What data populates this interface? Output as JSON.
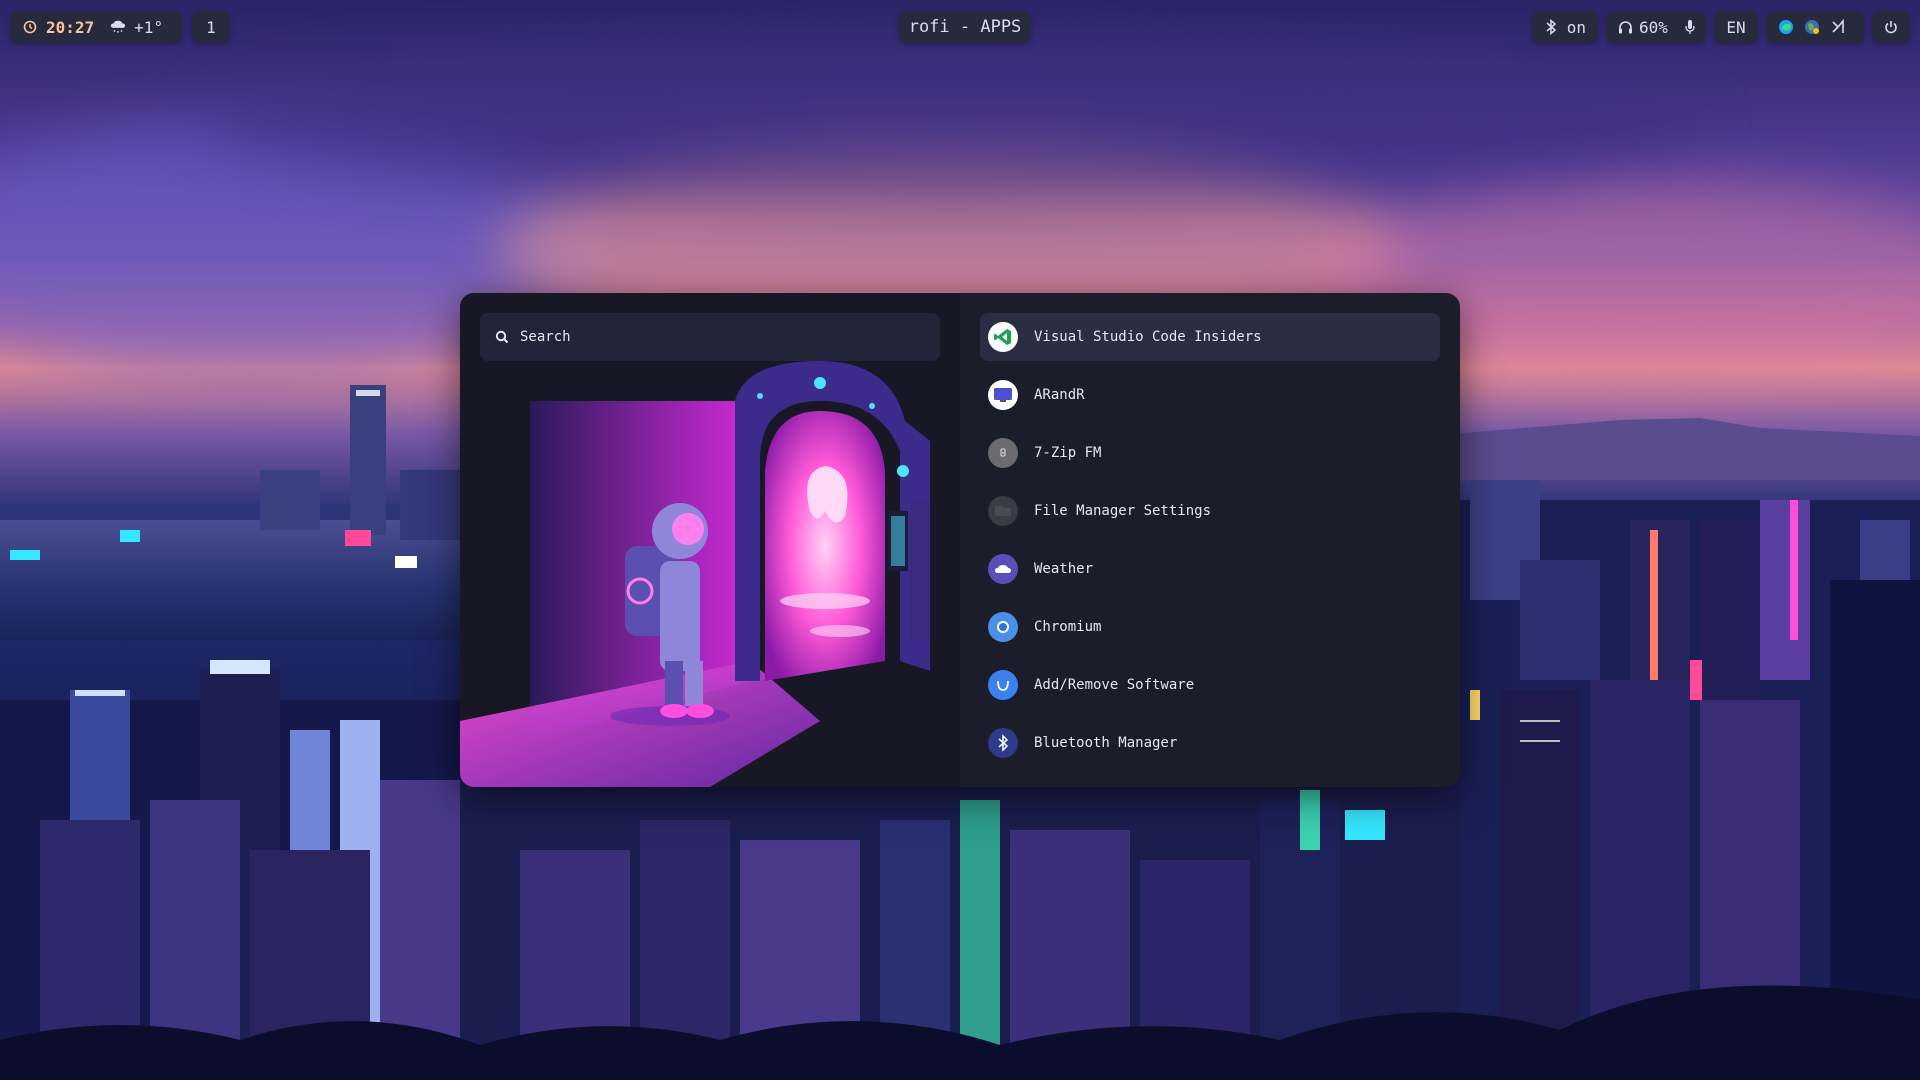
{
  "topbar": {
    "clock": "20:27",
    "weather": "+1°",
    "workspace": "1",
    "window_title": "rofi - APPS",
    "bluetooth": "on",
    "volume": "60%",
    "keyboard_layout": "EN",
    "icons": {
      "clock": "clock-icon",
      "weather": "cloud-snow-icon",
      "bluetooth": "bluetooth-icon",
      "volume": "headphones-icon",
      "mic": "microphone-icon",
      "tray": [
        "edge-browser-icon",
        "network-globe-icon",
        "vscode-icon"
      ],
      "power": "power-icon"
    }
  },
  "rofi": {
    "search": {
      "placeholder": "Search",
      "icon": "search-icon"
    },
    "apps": [
      {
        "label": "Visual Studio Code Insiders",
        "icon": "vscode-insiders-icon",
        "selected": true
      },
      {
        "label": "ARandR",
        "icon": "monitor-icon"
      },
      {
        "label": "7-Zip FM",
        "icon": "archive-icon"
      },
      {
        "label": "File Manager Settings",
        "icon": "folder-icon"
      },
      {
        "label": "Weather",
        "icon": "weather-icon"
      },
      {
        "label": "Chromium",
        "icon": "chromium-icon"
      },
      {
        "label": "Add/Remove Software",
        "icon": "package-icon"
      },
      {
        "label": "Bluetooth Manager",
        "icon": "bluetooth-icon"
      }
    ]
  },
  "colors": {
    "bar_bg": "#272a3c",
    "rofi_bg": "#1c1d2b",
    "selected_bg": "#2b2d42",
    "accent_pink": "#ff3fd0",
    "clock_accent": "#f5c49a"
  }
}
